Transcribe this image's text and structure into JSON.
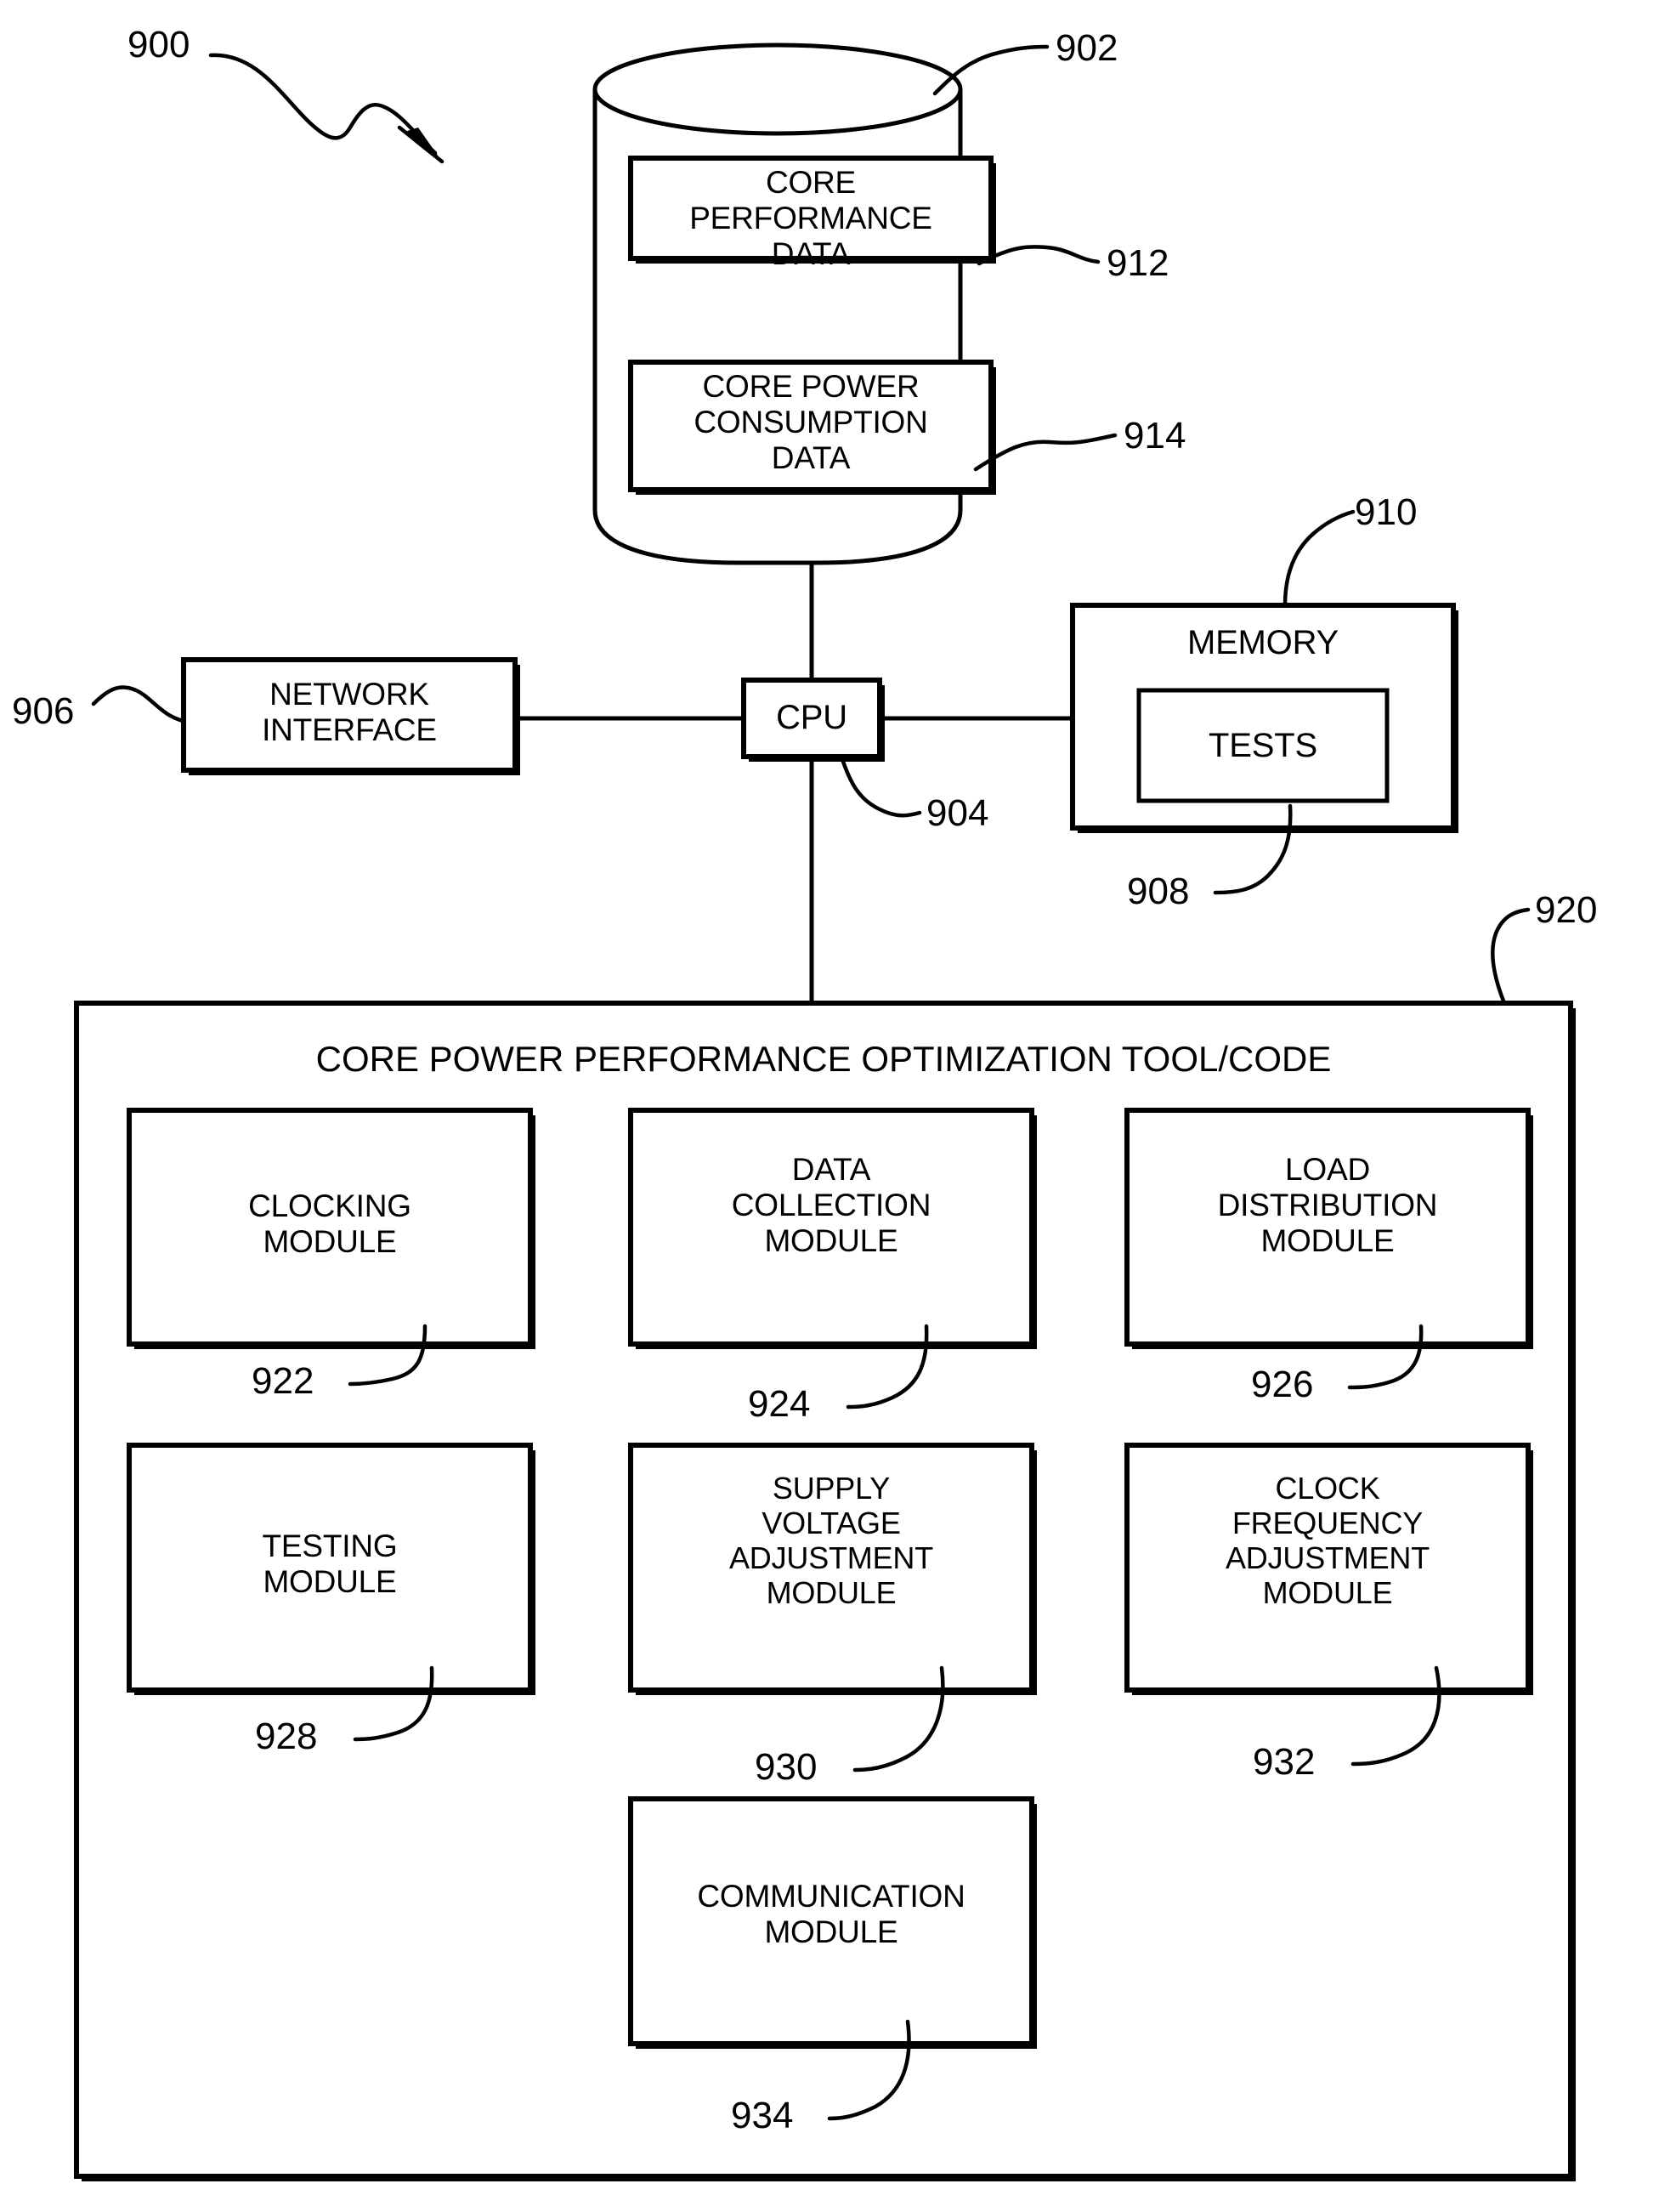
{
  "figure": {
    "id": "900",
    "title_ref": "900"
  },
  "storage": {
    "ref": "902",
    "blocks": [
      {
        "ref": "912",
        "label": "CORE\nPERFORMANCE\nDATA"
      },
      {
        "ref": "914",
        "label": "CORE POWER\nCONSUMPTION\nDATA"
      }
    ]
  },
  "cpu": {
    "ref": "904",
    "label": "CPU"
  },
  "network_interface": {
    "ref": "906",
    "label": "NETWORK\nINTERFACE"
  },
  "memory": {
    "ref": "910",
    "label": "MEMORY",
    "inner": {
      "ref": "908",
      "label": "TESTS"
    }
  },
  "tool": {
    "ref": "920",
    "title": "CORE POWER PERFORMANCE OPTIMIZATION TOOL/CODE",
    "modules": [
      {
        "ref": "922",
        "label": "CLOCKING\nMODULE"
      },
      {
        "ref": "924",
        "label": "DATA\nCOLLECTION\nMODULE"
      },
      {
        "ref": "926",
        "label": "LOAD\nDISTRIBUTION\nMODULE"
      },
      {
        "ref": "928",
        "label": "TESTING\nMODULE"
      },
      {
        "ref": "930",
        "label": "SUPPLY\nVOLTAGE\nADJUSTMENT\nMODULE"
      },
      {
        "ref": "932",
        "label": "CLOCK\nFREQUENCY\nADJUSTMENT\nMODULE"
      },
      {
        "ref": "934",
        "label": "COMMUNICATION\nMODULE"
      }
    ]
  },
  "colors": {
    "ink": "#000000",
    "paper": "#ffffff"
  }
}
